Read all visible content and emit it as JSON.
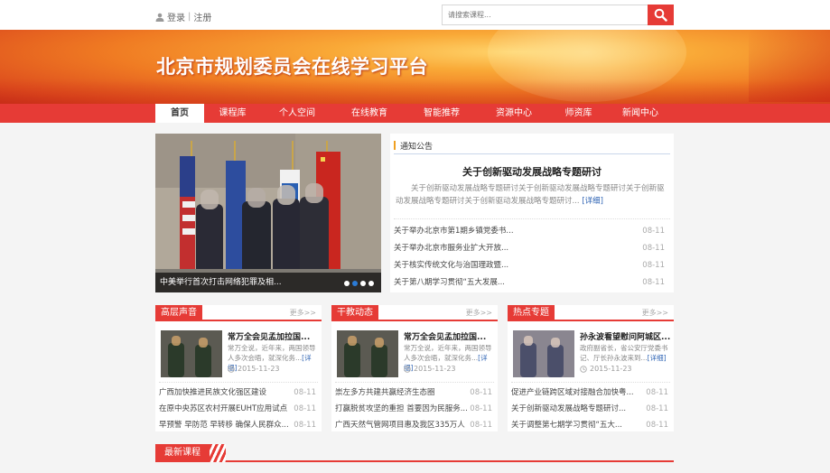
{
  "header": {
    "login": "登录",
    "separator": "|",
    "register": "注册",
    "search_placeholder": "请搜索课程..."
  },
  "banner": {
    "title": "北京市规划委员会在线学习平台"
  },
  "nav": {
    "items": [
      {
        "label": "首页",
        "active": true
      },
      {
        "label": "课程库"
      },
      {
        "label": "个人空间"
      },
      {
        "label": "在线教育"
      },
      {
        "label": "智能推荐"
      },
      {
        "label": "资源中心"
      },
      {
        "label": "师资库"
      },
      {
        "label": "新闻中心"
      }
    ]
  },
  "slider": {
    "caption": "中美举行首次打击网络犯罪及相...",
    "active_dot": 1,
    "dot_count": 4
  },
  "notice": {
    "heading": "通知公告",
    "title": "关于创新驱动发展战略专题研讨",
    "desc": "关于创新驱动发展战略专题研讨关于创新驱动发展战略专题研讨关于创新驱动发展战略专题研讨关于创新驱动发展战略专题研讨...",
    "more": "[详细]",
    "items": [
      {
        "text": "关于举办北京市第1期乡镇党委书...",
        "date": "08-11"
      },
      {
        "text": "关于举办北京市服务业扩大开放...",
        "date": "08-11"
      },
      {
        "text": "关于核实传统文化与治国理政暨...",
        "date": "08-11"
      },
      {
        "text": "关于第八期学习贯彻“五大发展...",
        "date": "08-11"
      }
    ]
  },
  "boxes": [
    {
      "heading": "高层声音",
      "more": "更多>>",
      "title": "常万全会见孟加拉国...",
      "desc": "常万全说，近年来，两国领导人多次会晤，就深化务...",
      "detail": "[详细]",
      "date": "2015-11-23",
      "items": [
        {
          "text": "广西加快推进民族文化强区建设",
          "date": "08-11"
        },
        {
          "text": "在原中央苏区农村开展EUHT应用试点",
          "date": "08-11"
        },
        {
          "text": "早预警 早防范 早转移 确保人民群众...",
          "date": "08-11"
        }
      ]
    },
    {
      "heading": "干教动态",
      "more": "更多>>",
      "title": "常万全会见孟加拉国...",
      "desc": "常万全说，近年来，两国领导人多次会晤，就深化务...",
      "detail": "[详细]",
      "date": "2015-11-23",
      "items": [
        {
          "text": "崇左多方共建共赢经济生态圈",
          "date": "08-11"
        },
        {
          "text": "打赢脱贫攻坚的重担 首要因为民服务...",
          "date": "08-11"
        },
        {
          "text": "广西天然气管网项目惠及我区335万人",
          "date": "08-11"
        }
      ]
    },
    {
      "heading": "热点专题",
      "more": "更多>>",
      "title": "孙永波看望慰问阿城区...",
      "desc": "政府副省长，省公安厅党委书记、厅长孙永波来到...",
      "detail": "[详细]",
      "date": "2015-11-23",
      "items": [
        {
          "text": "促进产业链跨区域对接融合加快粤...",
          "date": "08-11"
        },
        {
          "text": "关于创新驱动发展战略专题研讨...",
          "date": "08-11"
        },
        {
          "text": "关于调整第七期学习贯彻“五大...",
          "date": "08-11"
        }
      ]
    }
  ],
  "latest": {
    "heading": "最新课程"
  },
  "colors": {
    "accent": "#e63b36",
    "link": "#2f64b4",
    "notice_bar": "#f0a020"
  },
  "icons": [
    "user-icon",
    "search-icon",
    "clock-icon"
  ]
}
